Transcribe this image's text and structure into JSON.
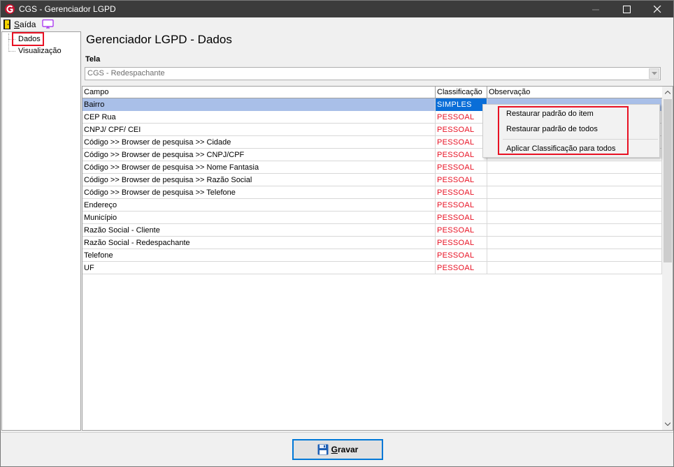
{
  "window": {
    "title": "CGS - Gerenciador LGPD",
    "minimize_glyph": "—",
    "maximize_glyph": "☐",
    "close_glyph": "✕"
  },
  "menubar": {
    "exit_label_prefix": "S",
    "exit_label_rest": "aída"
  },
  "tree": {
    "items": [
      {
        "label": "Dados",
        "selected": true
      },
      {
        "label": "Visualização",
        "selected": false
      }
    ]
  },
  "page": {
    "title": "Gerenciador LGPD - Dados",
    "tela_label": "Tela",
    "tela_value": "CGS - Redespachante"
  },
  "grid": {
    "columns": [
      "Campo",
      "Classificação",
      "Observação"
    ],
    "rows": [
      {
        "campo": "Bairro",
        "classificacao": "SIMPLES",
        "observacao": "",
        "selected": true
      },
      {
        "campo": "CEP Rua",
        "classificacao": "PESSOAL",
        "observacao": ""
      },
      {
        "campo": "CNPJ/ CPF/ CEI",
        "classificacao": "PESSOAL",
        "observacao": ""
      },
      {
        "campo": "Código >> Browser de pesquisa >> Cidade",
        "classificacao": "PESSOAL",
        "observacao": ""
      },
      {
        "campo": "Código >> Browser de pesquisa >> CNPJ/CPF",
        "classificacao": "PESSOAL",
        "observacao": ""
      },
      {
        "campo": "Código >> Browser de pesquisa >> Nome Fantasia",
        "classificacao": "PESSOAL",
        "observacao": ""
      },
      {
        "campo": "Código >> Browser de pesquisa >> Razão Social",
        "classificacao": "PESSOAL",
        "observacao": ""
      },
      {
        "campo": "Código >> Browser de pesquisa >> Telefone",
        "classificacao": "PESSOAL",
        "observacao": ""
      },
      {
        "campo": "Endereço",
        "classificacao": "PESSOAL",
        "observacao": ""
      },
      {
        "campo": "Município",
        "classificacao": "PESSOAL",
        "observacao": ""
      },
      {
        "campo": "Razão Social - Cliente",
        "classificacao": "PESSOAL",
        "observacao": ""
      },
      {
        "campo": "Razão Social - Redespachante",
        "classificacao": "PESSOAL",
        "observacao": ""
      },
      {
        "campo": "Telefone",
        "classificacao": "PESSOAL",
        "observacao": ""
      },
      {
        "campo": "UF",
        "classificacao": "PESSOAL",
        "observacao": ""
      }
    ]
  },
  "context_menu": {
    "items": [
      "Restaurar padrão do item",
      "Restaurar padrão de todos",
      "Aplicar Classificação para todos"
    ]
  },
  "footer": {
    "save_prefix": "G",
    "save_rest": "ravar"
  },
  "colors": {
    "titlebar": "#3c3c3c",
    "highlight_red": "#e81123",
    "selection_blue": "#0a6ed8",
    "pessoal_red": "#e81123"
  },
  "icons": {
    "app": "cgs-logo-icon",
    "exit": "exit-door-icon",
    "screen": "monitor-icon",
    "save": "floppy-disk-icon"
  }
}
